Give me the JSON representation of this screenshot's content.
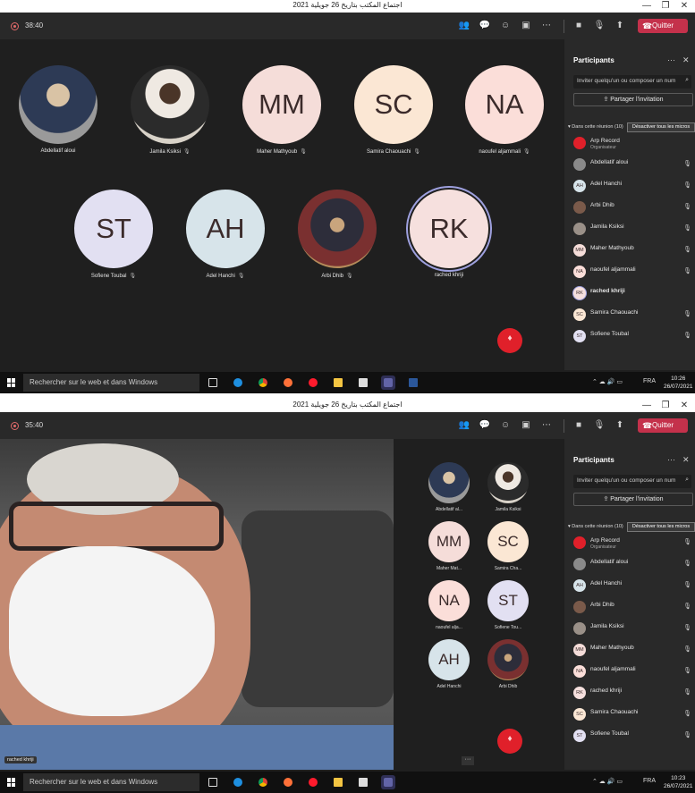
{
  "window": {
    "title": "اجتماع المكتب بتاريخ 26 جويلية 2021",
    "minimize": "—",
    "restore": "❐",
    "close": "✕"
  },
  "toolbar": {
    "leave_label": "Quitter",
    "icons": [
      "people-icon",
      "chat-icon",
      "reactions-icon",
      "share-tray-icon",
      "more-icon",
      "camera-icon",
      "mic-off-icon",
      "share-icon"
    ]
  },
  "screens": [
    {
      "timer": "38:40",
      "clock_time": "10:26",
      "clock_date": "26/07/2021",
      "participants_order": [
        "Arp Record",
        "Abdellatif aloui",
        "Adel Hanchi",
        "Arbi Dhib",
        "Jamila Ksiksi",
        "Maher Mathyoub",
        "naoufel aljammali",
        "rached khriji",
        "Samira Chaouachi",
        "Sofiene Toubal"
      ]
    },
    {
      "timer": "35:40",
      "clock_time": "10:23",
      "clock_date": "26/07/2021",
      "spotlight_name": "rached khriji",
      "gallery": [
        {
          "name": "Abdellatif al...",
          "initials": "",
          "photo": true
        },
        {
          "name": "Jamila Ksiksi",
          "initials": "",
          "photo": true
        },
        {
          "name": "Maher Mat...",
          "initials": "MM"
        },
        {
          "name": "Samira Cha...",
          "initials": "SC"
        },
        {
          "name": "naoufel alja...",
          "initials": "NA"
        },
        {
          "name": "Sofiene Tou...",
          "initials": "ST"
        },
        {
          "name": "Adel Hanchi",
          "initials": "AH"
        },
        {
          "name": "Arbi Dhib",
          "initials": "",
          "photo": true
        }
      ],
      "more_label": "···"
    }
  ],
  "stage_tiles": [
    {
      "name": "Abdellatif aloui",
      "initials": ""
    },
    {
      "name": "Jamila Ksiksi",
      "initials": ""
    },
    {
      "name": "Maher Mathyoub",
      "initials": "MM"
    },
    {
      "name": "Samira Chaouachi",
      "initials": "SC"
    },
    {
      "name": "naoufel aljammali",
      "initials": "NA"
    },
    {
      "name": "Sofiene Toubal",
      "initials": "ST"
    },
    {
      "name": "Adel Hanchi",
      "initials": "AH"
    },
    {
      "name": "Arbi Dhib",
      "initials": ""
    },
    {
      "name": "rached khriji",
      "initials": "RK"
    }
  ],
  "panel": {
    "title": "Participants",
    "more": "···",
    "close": "✕",
    "invite_placeholder": "Inviter quelqu'un ou composer un num",
    "share_invite": "Partager l'invitation",
    "section_label": "▾ Dans cette réunion (10)",
    "mute_all": "Désactiver tous les micros",
    "organizer_role": "Organisateur",
    "participants": [
      {
        "name": "Arp Record",
        "initials": "",
        "role": true
      },
      {
        "name": "Abdellatif aloui",
        "initials": ""
      },
      {
        "name": "Adel Hanchi",
        "initials": "AH"
      },
      {
        "name": "Arbi Dhib",
        "initials": ""
      },
      {
        "name": "Jamila Ksiksi",
        "initials": ""
      },
      {
        "name": "Maher Mathyoub",
        "initials": "MM"
      },
      {
        "name": "naoufel aljammali",
        "initials": "NA"
      },
      {
        "name": "rached khriji",
        "initials": "RK"
      },
      {
        "name": "Samira Chaouachi",
        "initials": "SC"
      },
      {
        "name": "Sofiene Toubal",
        "initials": "ST"
      }
    ]
  },
  "taskbar": {
    "search_placeholder": "Rechercher sur le web et dans Windows",
    "lang": "FRA",
    "tray_icons": "⌃ ☁ 🔊 ▭"
  },
  "colors": {
    "MM": "#f5ddd9",
    "SC": "#fbe7d4",
    "NA": "#fbded9",
    "ST": "#e2e0f2",
    "AH": "#d7e4ea",
    "RK": "#f6e0de",
    "accent_leave": "#c4314b",
    "self_red": "#e0202a"
  }
}
